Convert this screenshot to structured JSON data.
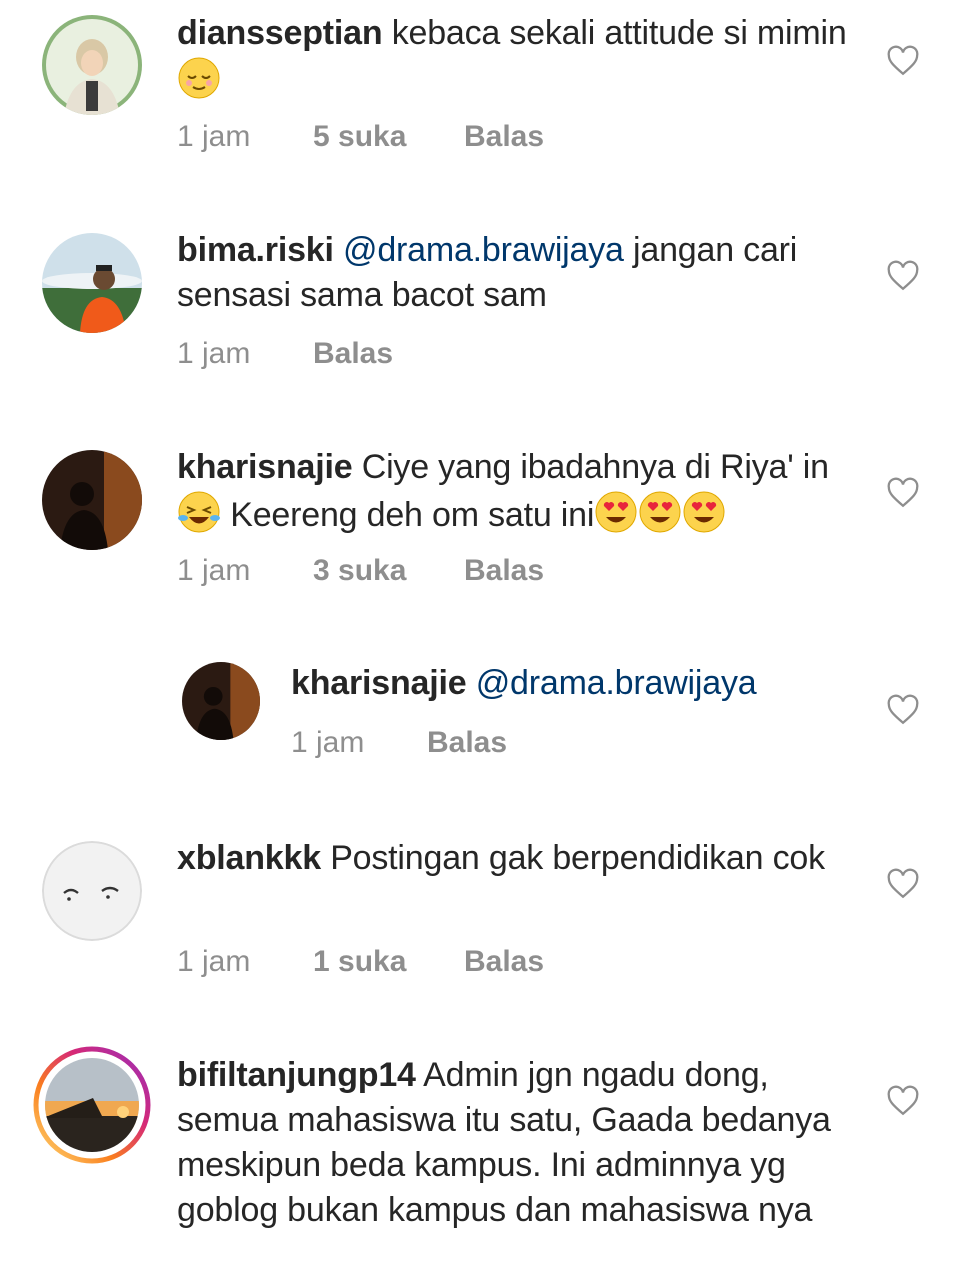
{
  "comments": [
    {
      "username": "diansseptian",
      "text_before": "kebaca sekali attitude si mimin",
      "emoji": [
        "relieved-face-emoji"
      ],
      "time": "1 jam",
      "likes": "5 suka",
      "reply": "Balas"
    },
    {
      "username": "bima.riski",
      "mention": "@drama.brawijaya",
      "text_after": "jangan cari sensasi sama bacot sam",
      "time": "1 jam",
      "reply": "Balas"
    },
    {
      "username": "kharisnajie",
      "text_before": "Ciye yang ibadahnya di Riya' in",
      "text_middle": "Keereng deh om satu ini",
      "emoji": [
        "tears-of-joy-emoji",
        "heart-eyes-emoji",
        "heart-eyes-emoji",
        "heart-eyes-emoji"
      ],
      "time": "1 jam",
      "likes": "3 suka",
      "reply": "Balas"
    },
    {
      "username": "kharisnajie",
      "mention": "@drama.brawijaya",
      "time": "1 jam",
      "reply": "Balas"
    },
    {
      "username": "xblankkk",
      "text_before": "Postingan gak berpendidikan cok",
      "time": "1 jam",
      "likes": "1 suka",
      "reply": "Balas"
    },
    {
      "username": "bifiltanjungp14",
      "text_before": "Admin jgn ngadu dong, semua mahasiswa itu satu, Gaada bedanya meskipun beda kampus. Ini adminnya yg goblog bukan kampus dan mahasiswa nya"
    }
  ],
  "icons": {
    "like": "heart-outline-icon"
  },
  "colors": {
    "text": "#262626",
    "meta": "#8e8e8e",
    "mention": "#00376b",
    "story_ring": "#e1306c"
  }
}
